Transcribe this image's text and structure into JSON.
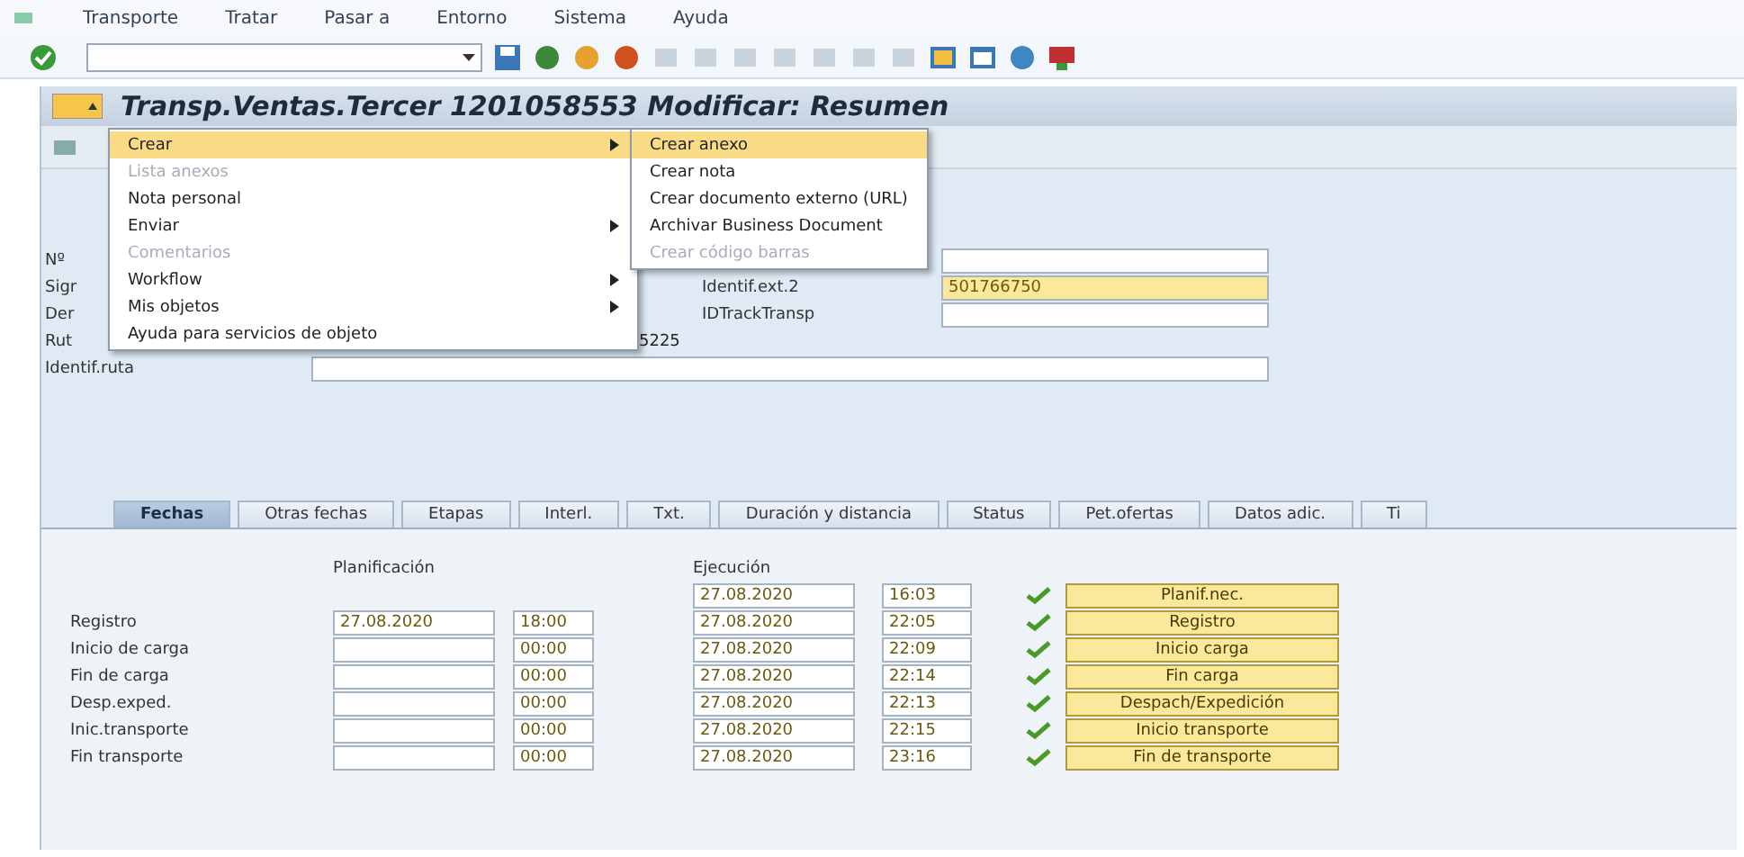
{
  "menubar": [
    "Transporte",
    "Tratar",
    "Pasar a",
    "Entorno",
    "Sistema",
    "Ayuda"
  ],
  "title": "Transp.Ventas.Tercer 1201058553 Modificar: Resumen",
  "context_menu": [
    {
      "label": "Crear",
      "submenu": true,
      "disabled": false,
      "selected": true
    },
    {
      "label": "Lista anexos",
      "submenu": false,
      "disabled": true,
      "selected": false
    },
    {
      "label": "Nota personal",
      "submenu": false,
      "disabled": false,
      "selected": false
    },
    {
      "label": "Enviar",
      "submenu": true,
      "disabled": false,
      "selected": false
    },
    {
      "label": "Comentarios",
      "submenu": false,
      "disabled": true,
      "selected": false
    },
    {
      "label": "Workflow",
      "submenu": true,
      "disabled": false,
      "selected": false
    },
    {
      "label": "Mis objetos",
      "submenu": true,
      "disabled": false,
      "selected": false
    },
    {
      "label": "Ayuda para servicios de objeto",
      "submenu": false,
      "disabled": false,
      "selected": false
    }
  ],
  "submenu": [
    {
      "label": "Crear anexo",
      "disabled": false,
      "selected": true
    },
    {
      "label": "Crear nota",
      "disabled": false,
      "selected": false
    },
    {
      "label": "Crear documento externo (URL)",
      "disabled": false,
      "selected": false
    },
    {
      "label": "Archivar Business Document",
      "disabled": false,
      "selected": false
    },
    {
      "label": "Crear código barras",
      "disabled": true,
      "selected": false
    }
  ],
  "header": [
    {
      "label": "Nº",
      "right": {
        "highlight": false
      }
    },
    {
      "label": "Sigr",
      "right": {
        "label": "Identif.ext.2",
        "value": "501766750",
        "highlight": true
      }
    },
    {
      "label": "Der",
      "right": {
        "label": "IDTrackTransp",
        "highlight": false
      }
    },
    {
      "label": "Rut",
      "value": "5225"
    }
  ],
  "route": {
    "label": "Identif.ruta"
  },
  "tabs": [
    {
      "label": "Fechas",
      "selected": true
    },
    {
      "label": "Otras fechas",
      "selected": false
    },
    {
      "label": "Etapas",
      "selected": false
    },
    {
      "label": "Interl.",
      "selected": false
    },
    {
      "label": "Txt.",
      "selected": false
    },
    {
      "label": "Duración y distancia",
      "selected": false
    },
    {
      "label": "Status",
      "selected": false
    },
    {
      "label": "Pet.ofertas",
      "selected": false
    },
    {
      "label": "Datos adic.",
      "selected": false
    },
    {
      "label": "Ti",
      "selected": false
    }
  ],
  "dates": {
    "plan_header": "Planificación",
    "exec_header": "Ejecución",
    "rows": [
      {
        "exec_date": "27.08.2020",
        "exec_time": "16:03",
        "button": "Planif.nec."
      },
      {
        "label": "Registro",
        "plan_date": "27.08.2020",
        "plan_time": "18:00",
        "exec_date": "27.08.2020",
        "exec_time": "22:05",
        "button": "Registro"
      },
      {
        "label": "Inicio de carga",
        "plan_time": "00:00",
        "exec_date": "27.08.2020",
        "exec_time": "22:09",
        "button": "Inicio carga"
      },
      {
        "label": "Fin de carga",
        "plan_time": "00:00",
        "exec_date": "27.08.2020",
        "exec_time": "22:14",
        "button": "Fin carga"
      },
      {
        "label": "Desp.exped.",
        "plan_time": "00:00",
        "exec_date": "27.08.2020",
        "exec_time": "22:13",
        "button": "Despach/Expedición"
      },
      {
        "label": "Inic.transporte",
        "plan_time": "00:00",
        "exec_date": "27.08.2020",
        "exec_time": "22:15",
        "button": "Inicio transporte"
      },
      {
        "label": "Fin transporte",
        "plan_time": "00:00",
        "exec_date": "27.08.2020",
        "exec_time": "23:16",
        "button": "Fin de transporte"
      }
    ]
  }
}
